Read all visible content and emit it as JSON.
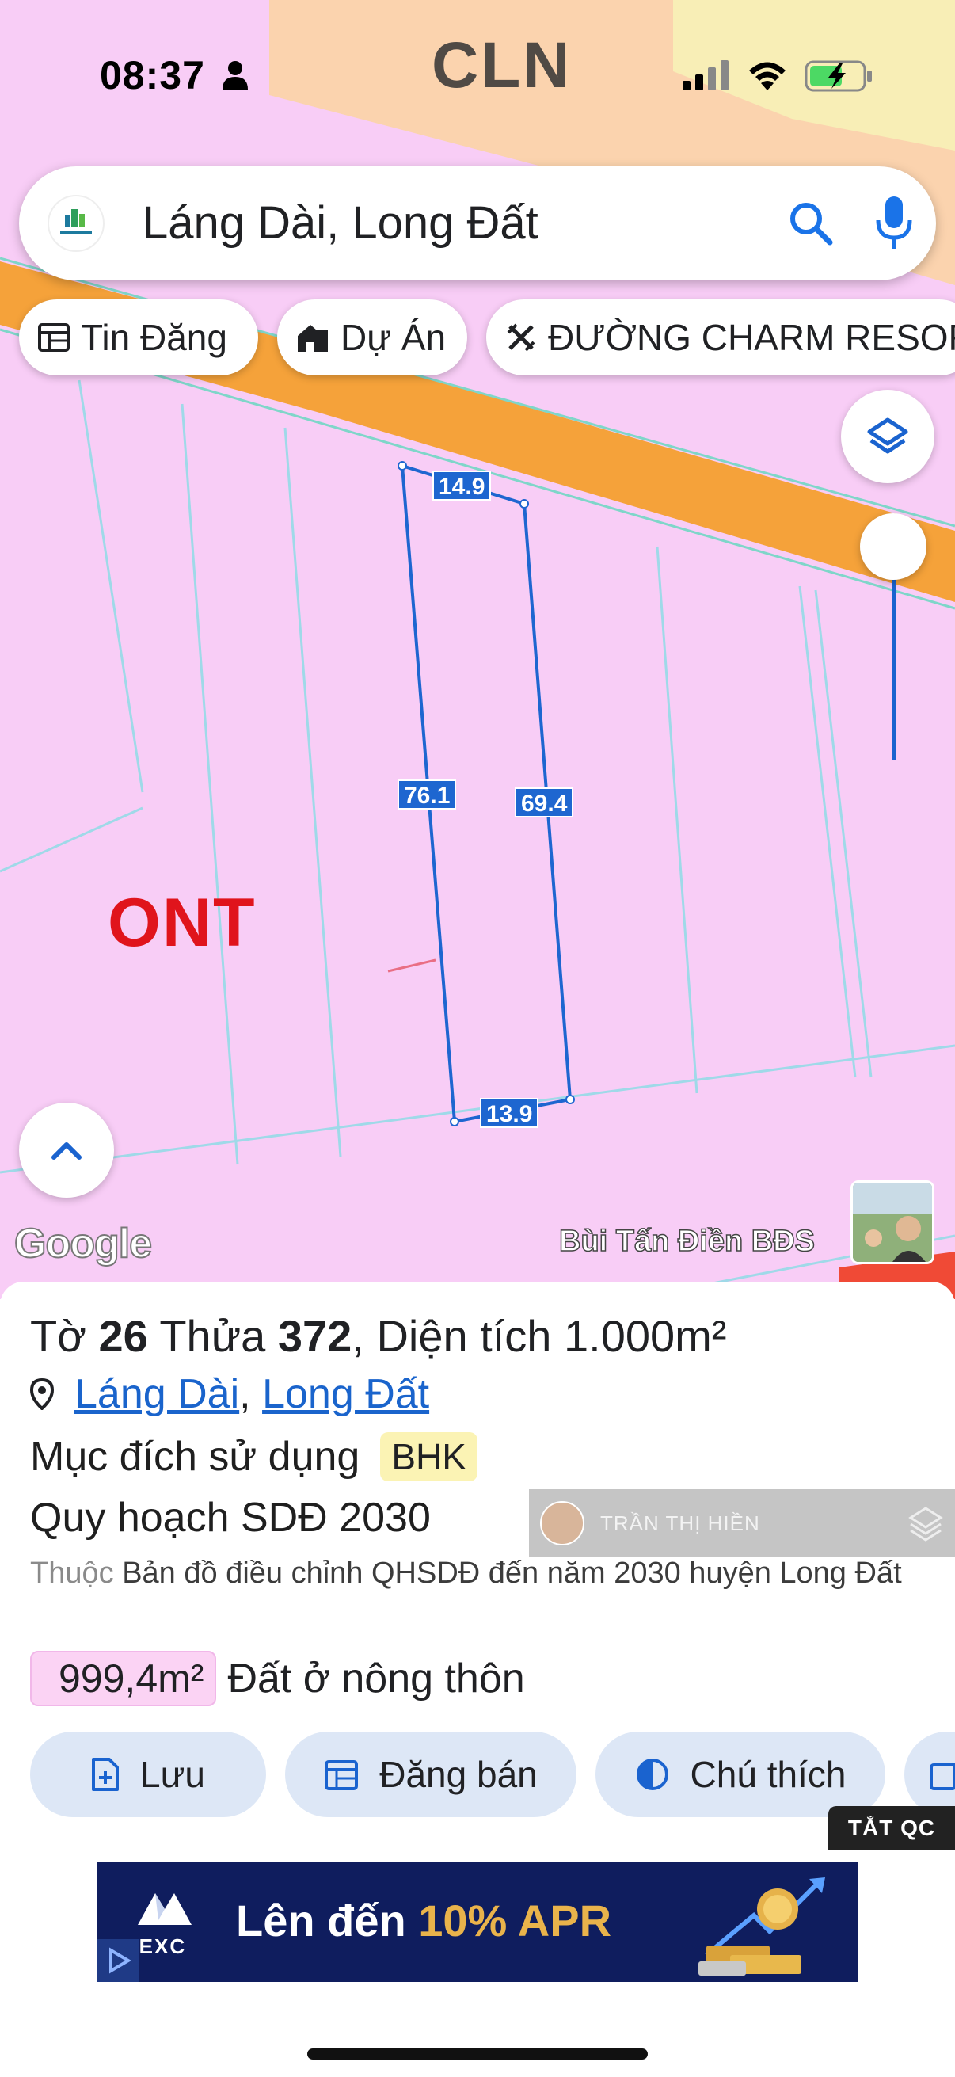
{
  "status_bar": {
    "time": "08:37"
  },
  "search": {
    "query": "Láng Dài, Long Đất"
  },
  "chips": [
    {
      "label": "Tin Đăng",
      "icon": "listing-icon"
    },
    {
      "label": "Dự Án",
      "icon": "buildings-icon"
    },
    {
      "label": "ĐƯỜNG CHARM RESOR",
      "icon": "road-icon"
    }
  ],
  "map": {
    "zones": {
      "top": "CLN",
      "main": "ONT"
    },
    "measurements": {
      "top": "14.9",
      "left": "76.1",
      "right": "69.4",
      "bottom": "13.9"
    },
    "attribution": "Google",
    "author": "Bùi Tấn Điền BĐS"
  },
  "parcel": {
    "title_sheet_label": "Tờ",
    "sheet_no": "26",
    "title_plot_label": "Thửa",
    "plot_no": "372",
    "title_area_label": ", Diện tích",
    "area": "1.000m²",
    "location_a": "Láng Dài",
    "location_sep": ", ",
    "location_b": "Long Đất",
    "purpose_label": "Mục đích sử dụng",
    "purpose_code": "BHK",
    "plan_title": "Quy hoạch SDĐ 2030",
    "source_prefix": "Thuộc",
    "source_text": "Bản đồ điều chỉnh QHSDĐ đến năm 2030 huyện Long Đất",
    "plan_area": "999,4m²",
    "plan_area_label": "Đất ở nông thôn"
  },
  "actions": {
    "save": "Lưu",
    "post": "Đăng bán",
    "legend": "Chú thích"
  },
  "overlay_ad": {
    "name": "TRẦN THỊ HIỀN"
  },
  "ads": {
    "close_label": "TẮT QC",
    "brand": "MEXC",
    "text_prefix": "Lên đến ",
    "text_highlight": "10% APR"
  },
  "colors": {
    "ont_zone": "#f8cdf6",
    "cln_zone": "#fbd3ae",
    "road": "#f5a23a",
    "boundary": "#1e66d0",
    "link": "#1a64cc"
  }
}
